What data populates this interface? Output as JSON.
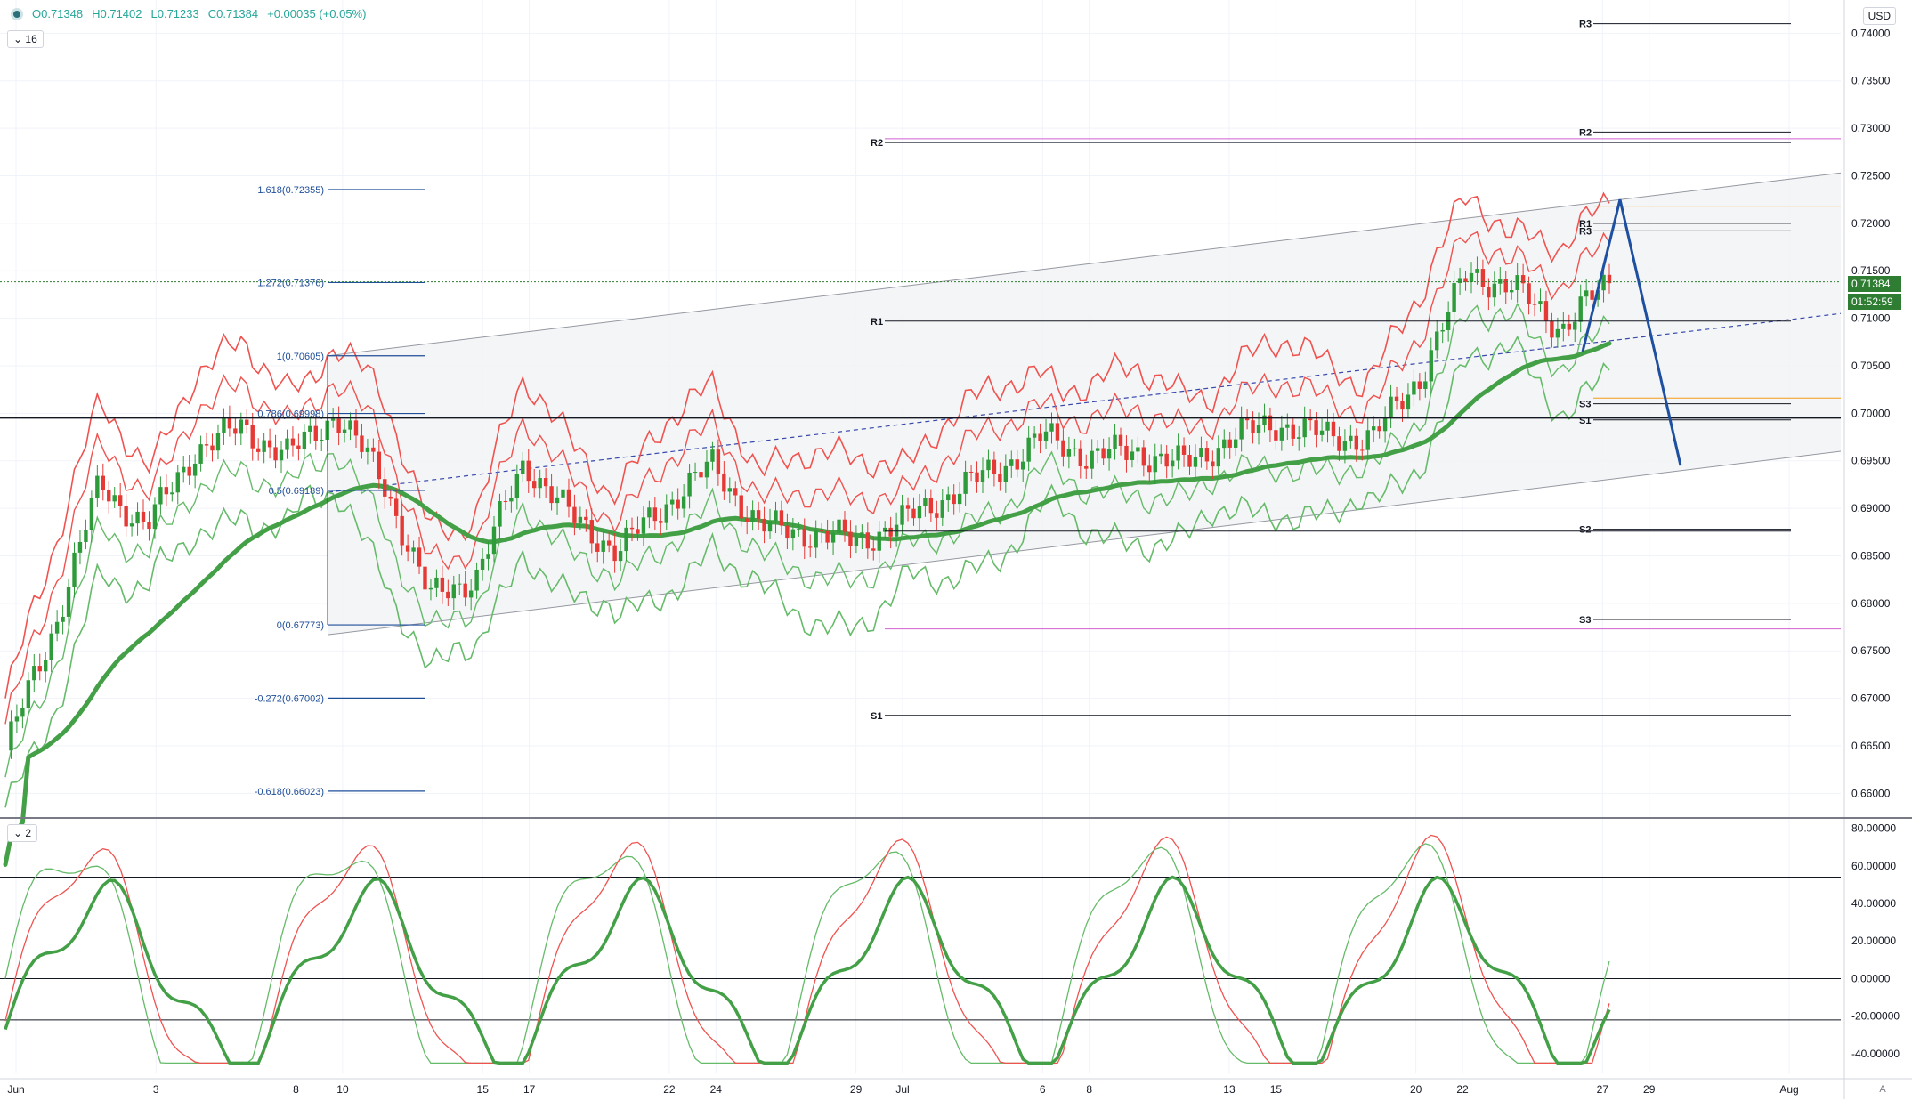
{
  "header": {
    "open": "O0.71348",
    "high": "H0.71402",
    "low": "L0.71233",
    "close": "C0.71384",
    "change": "+0.00035 (+0.05%)",
    "main_pane_label": "16",
    "osc_pane_label": "2",
    "currency": "USD",
    "auto": "A"
  },
  "price_tags": {
    "last": "0.71384",
    "countdown": "01:52:59"
  },
  "chart_data": {
    "type": "candlestick",
    "symbol_currency": "USD",
    "price_axis": {
      "ticks": [
        "0.74000",
        "0.73500",
        "0.73000",
        "0.72500",
        "0.72000",
        "0.71500",
        "0.71000",
        "0.70500",
        "0.70000",
        "0.69500",
        "0.69000",
        "0.68500",
        "0.68000",
        "0.67500",
        "0.67000",
        "0.66500",
        "0.66000"
      ],
      "range": [
        0.6575,
        0.7435
      ]
    },
    "osc_axis": {
      "ticks": [
        "80.00000",
        "60.00000",
        "40.00000",
        "20.00000",
        "0.00000",
        "-20.00000",
        "-40.00000"
      ],
      "range": [
        -50,
        85
      ],
      "levels": [
        54,
        0,
        -22
      ]
    },
    "time_axis": {
      "labels": [
        "Jun",
        "3",
        "8",
        "10",
        "15",
        "17",
        "22",
        "24",
        "29",
        "Jul",
        "6",
        "8",
        "13",
        "15",
        "20",
        "22",
        "27",
        "29",
        "Aug"
      ],
      "label_bars": [
        0,
        3,
        6,
        7,
        10,
        11,
        14,
        15,
        18,
        19,
        22,
        23,
        26,
        27,
        30,
        31,
        34,
        35,
        38
      ]
    },
    "candles_note": "bar index, open, high, low, close (estimated; 8 bars per day approx)",
    "daily_closes": [
      0.6645,
      0.677,
      0.6925,
      0.688,
      0.696,
      0.6985,
      0.6955,
      0.7,
      0.693,
      0.6805,
      0.683,
      0.695,
      0.689,
      0.6855,
      0.6905,
      0.6945,
      0.688,
      0.6875,
      0.6865,
      0.6885,
      0.6915,
      0.694,
      0.6975,
      0.6955,
      0.696,
      0.6945,
      0.6975,
      0.699,
      0.6975,
      0.6975,
      0.704,
      0.715,
      0.713,
      0.709,
      0.7138
    ],
    "fibonacci": [
      {
        "label": "1.618(0.72355)",
        "value": 0.72355
      },
      {
        "label": "1.272(0.71376)",
        "value": 0.71376
      },
      {
        "label": "1(0.70605)",
        "value": 0.70605
      },
      {
        "label": "0.786(0.69998)",
        "value": 0.69998
      },
      {
        "label": "0.5(0.69189)",
        "value": 0.69189
      },
      {
        "label": "0(0.67773)",
        "value": 0.67773
      },
      {
        "label": "-0.272(0.67002)",
        "value": 0.67002
      },
      {
        "label": "-0.618(0.66023)",
        "value": 0.66023
      }
    ],
    "pivots_monthly": [
      {
        "label": "R2",
        "value": 0.7285
      },
      {
        "label": "R1",
        "value": 0.7097
      },
      {
        "label": "S1",
        "value": 0.6682
      }
    ],
    "pivots_weekly": [
      {
        "label": "R3",
        "value": 0.741
      },
      {
        "label": "R2",
        "value": 0.7296
      },
      {
        "label": "R1",
        "value": 0.72
      },
      {
        "label": "R3",
        "value": 0.7192
      },
      {
        "label": "S3",
        "value": 0.701
      },
      {
        "label": "S1",
        "value": 0.6993
      },
      {
        "label": "S2",
        "value": 0.6878
      },
      {
        "label": "S3",
        "value": 0.6783
      }
    ],
    "current_price": 0.71384,
    "colors": {
      "up": "#26a69a",
      "up_body": "#2e9b3a",
      "down": "#e53935",
      "ma_up": "#43a047",
      "ma_down": "#ef5350",
      "band_red": "#ef5350",
      "band_green": "#66bb6a",
      "fib": "#1f4e99",
      "pivot": "#131722",
      "orange": "#f59c1a",
      "magenta": "#d25fd2",
      "arrow": "#1e4fa0",
      "channel": "#9598a1"
    }
  }
}
